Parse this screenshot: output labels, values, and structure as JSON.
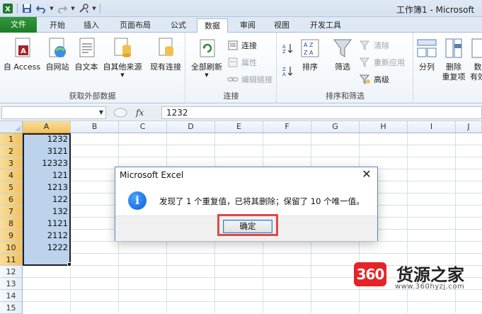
{
  "window": {
    "title": "工作簿1 - Microsoft"
  },
  "ribbon_tabs": [
    "文件",
    "开始",
    "插入",
    "页面布局",
    "公式",
    "数据",
    "审阅",
    "视图",
    "开发工具"
  ],
  "active_tab": "数据",
  "groups": {
    "external": {
      "label": "获取外部数据",
      "buttons": [
        "自 Access",
        "自网站",
        "自文本",
        "自其他来源",
        "现有连接"
      ]
    },
    "connections": {
      "label": "连接",
      "refresh_label": "全部刷新",
      "small": [
        "连接",
        "属性",
        "编辑链接"
      ]
    },
    "sort_filter": {
      "label": "排序和筛选",
      "sort_label": "排序",
      "filter_label": "筛选",
      "small": [
        "清除",
        "重新应用",
        "高级"
      ]
    },
    "data_tools": {
      "split_label": "分列",
      "remove_dup_line1": "删除",
      "remove_dup_line2": "重复项",
      "validation_line1": "数",
      "validation_line2": "有效"
    }
  },
  "formula_bar": {
    "name_box": "",
    "fx": "fx",
    "value": "1232"
  },
  "columns": [
    "A",
    "B",
    "C",
    "D",
    "E",
    "F",
    "G",
    "H",
    "I",
    "J"
  ],
  "rows": [
    "1",
    "2",
    "3",
    "4",
    "5",
    "6",
    "7",
    "8",
    "9",
    "10",
    "11",
    "12",
    "13",
    "14",
    "15"
  ],
  "column_a_values": [
    "1232",
    "3121",
    "12323",
    "121",
    "1213",
    "122",
    "132",
    "1121",
    "2112",
    "1222"
  ],
  "dialog": {
    "title": "Microsoft Excel",
    "close": "✕",
    "info_glyph": "i",
    "message": "发现了 1 个重复值，已将其删除；保留了 10 个唯一值。",
    "ok_label": "确定"
  },
  "watermark": {
    "badge": "360",
    "name": "货源之家",
    "url": "www.360hyzj.com"
  },
  "colors": {
    "file_tab": "#1f7b2a",
    "selection": "#bcd3eb",
    "highlight_box": "#e04848",
    "header_selected": "#f1c15f"
  }
}
